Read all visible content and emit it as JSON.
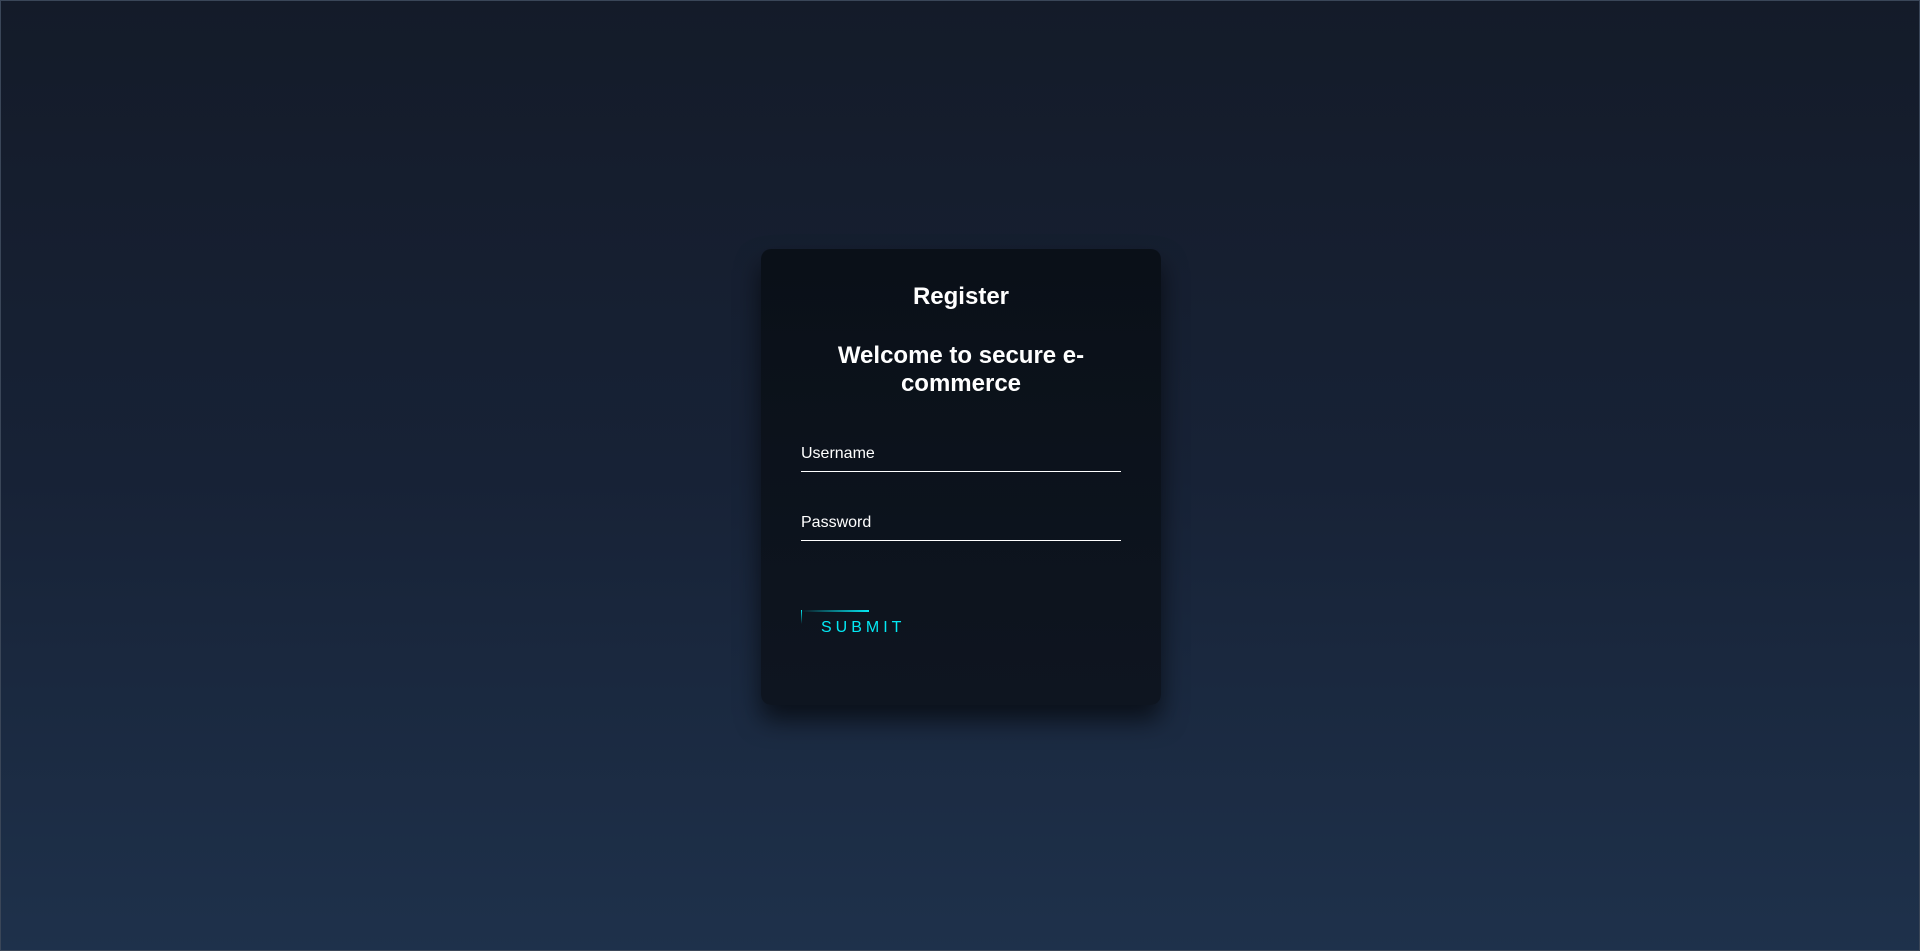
{
  "form": {
    "title": "Register",
    "subtitle": "Welcome to secure e-commerce",
    "username_label": "Username",
    "password_label": "Password",
    "submit_label": "SUBMIT"
  },
  "colors": {
    "accent": "#03e9f4",
    "card_background": "#0b111a",
    "page_gradient_top": "#141b29",
    "page_gradient_bottom": "#1e314b"
  }
}
